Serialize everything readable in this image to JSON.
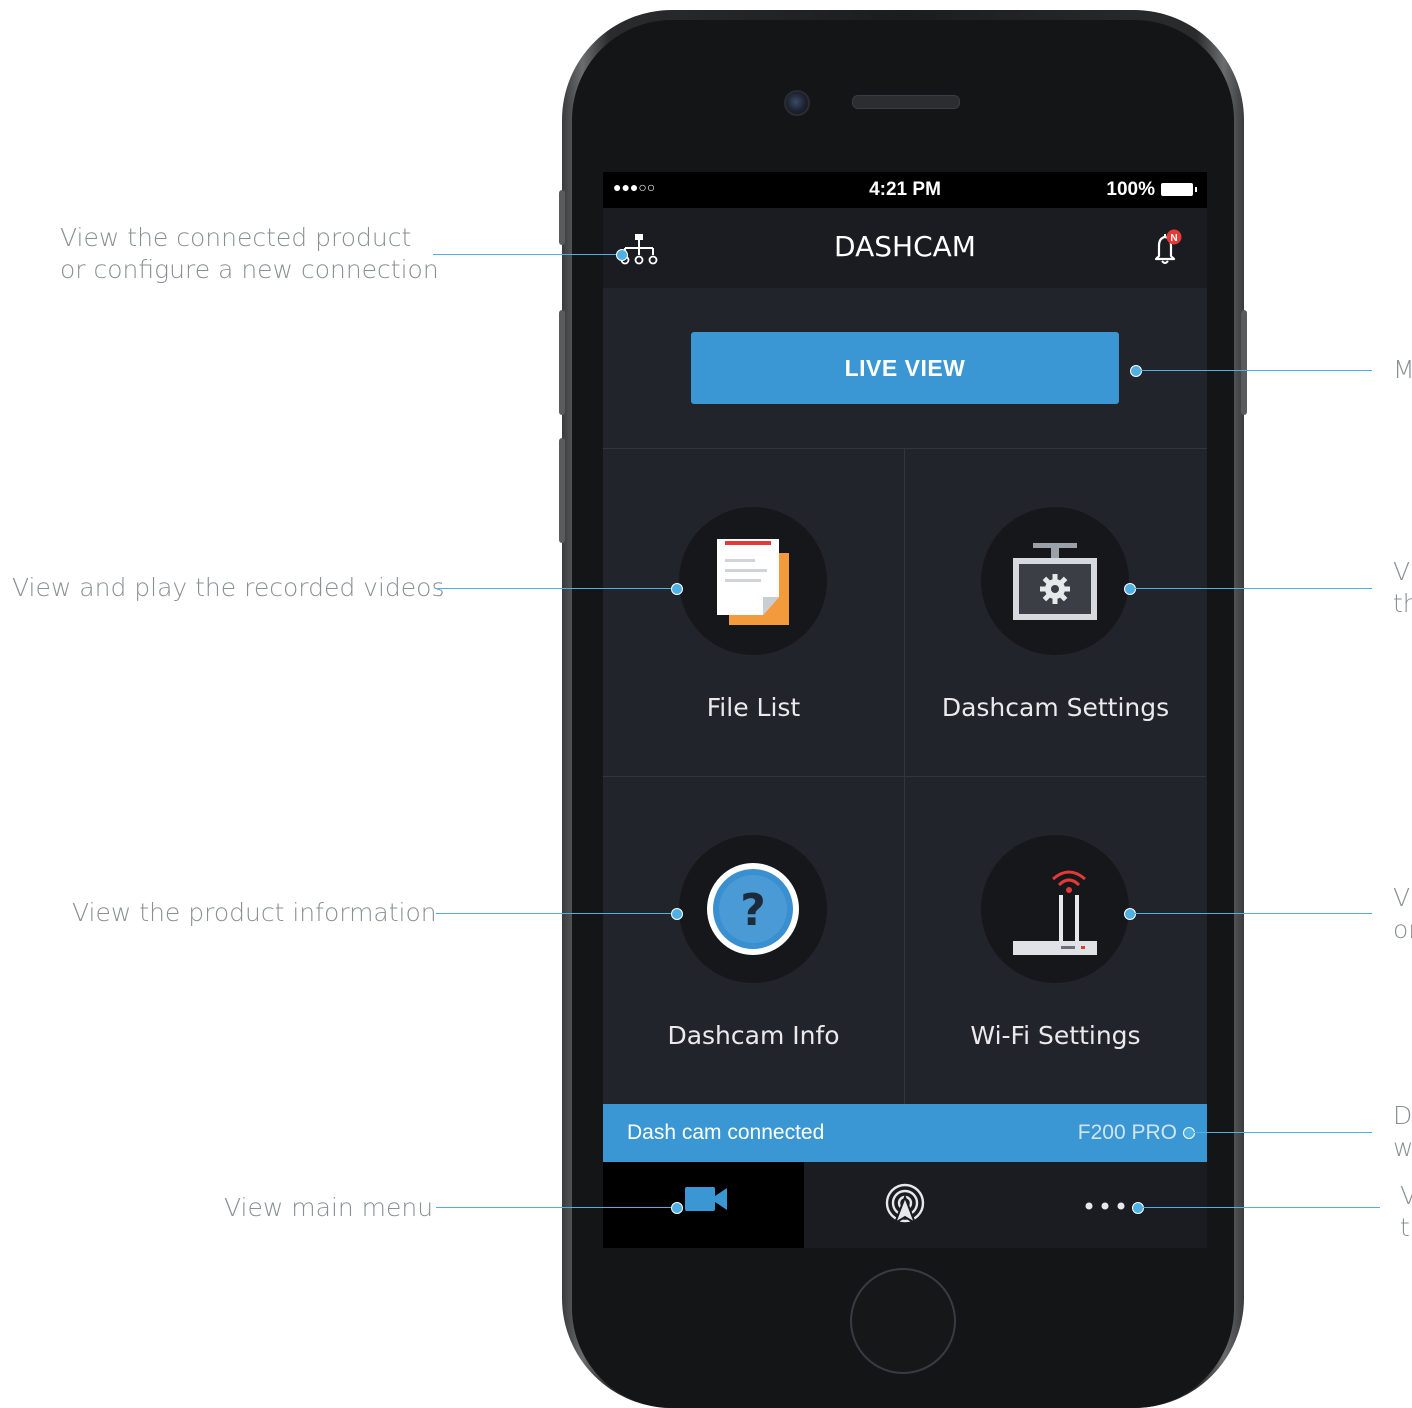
{
  "app": {
    "title": "DASHCAM",
    "status": {
      "signal": "●●●○○",
      "time": "4:21 PM",
      "battery": "100%"
    },
    "notification_badge": "N",
    "live_view_label": "LIVE VIEW",
    "tiles": [
      {
        "label": "File List",
        "icon": "file-list-icon"
      },
      {
        "label": "Dashcam Settings",
        "icon": "dashcam-settings-icon"
      },
      {
        "label": "Dashcam Info",
        "icon": "help-info-icon"
      },
      {
        "label": "Wi-Fi Settings",
        "icon": "wifi-router-icon"
      }
    ],
    "connection": {
      "status_text": "Dash cam connected",
      "model": "F200 PRO"
    },
    "tabs": [
      {
        "icon": "video-camera-icon",
        "active": true
      },
      {
        "icon": "broadcast-icon",
        "active": false
      },
      {
        "icon": "more-dots-icon",
        "active": false
      }
    ]
  },
  "callouts": {
    "connection": {
      "line1": "View the connected product",
      "line2": "or configure a new connection"
    },
    "videos": "View and play the recorded videos",
    "product_info": "View the product information",
    "main_menu": "View main menu",
    "right_live": "M",
    "right_settings": {
      "line1": "Vi",
      "line2": "th"
    },
    "right_wifi": {
      "line1": "Vi",
      "line2": "or"
    },
    "right_conn": {
      "line1": "D",
      "line2": "w"
    },
    "right_more": {
      "line1": "V",
      "line2": "t"
    }
  },
  "colors": {
    "accent": "#3a97d4",
    "callout_line": "#4fb1e3",
    "screen_bg": "#202329",
    "notification_red": "#e53935"
  }
}
